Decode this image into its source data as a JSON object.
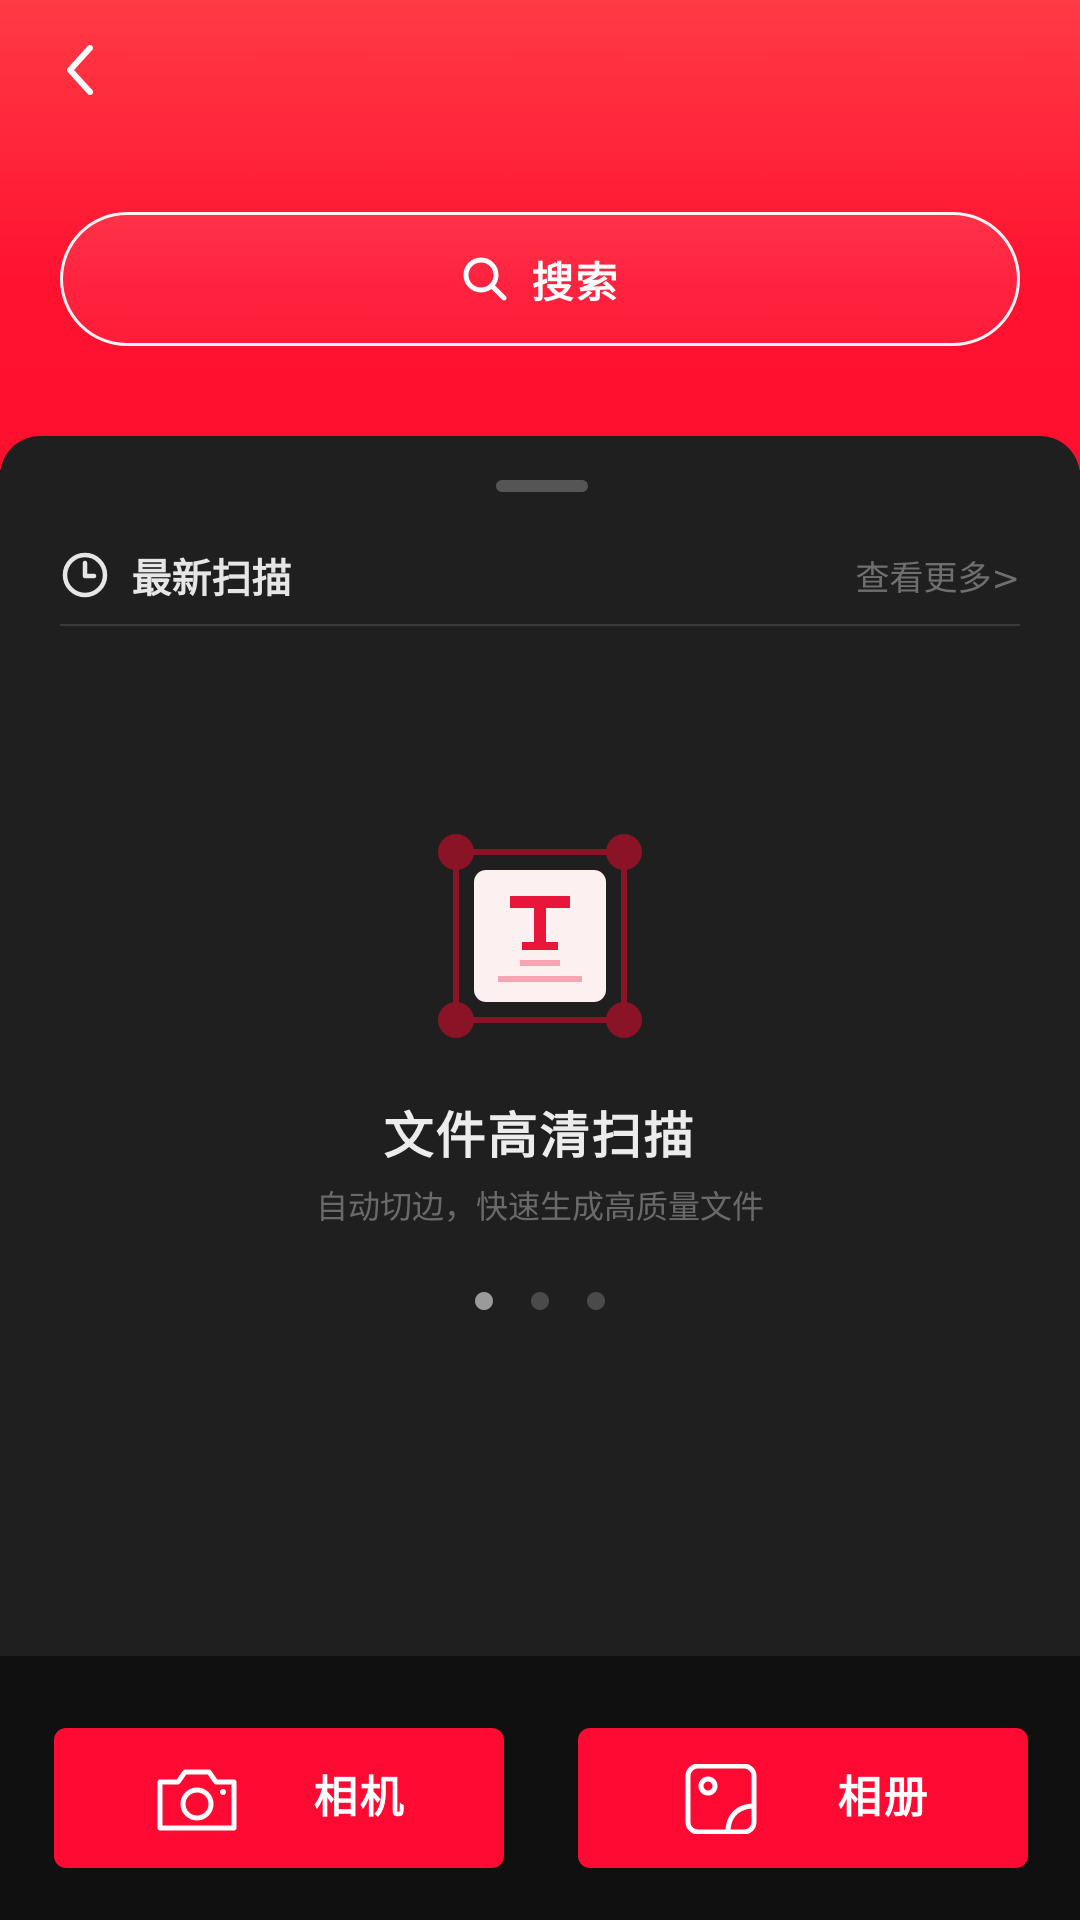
{
  "header": {
    "back_icon": "chevron-left-icon",
    "search": {
      "label": "搜索",
      "icon": "search-icon"
    }
  },
  "recent": {
    "title": "最新扫描",
    "icon": "clock-icon",
    "see_more": "查看更多>"
  },
  "feature": {
    "icon": "text-scan-icon",
    "title": "文件高清扫描",
    "subtitle": "自动切边，快速生成高质量文件",
    "pagination": {
      "current": 1,
      "total": 3
    }
  },
  "actions": {
    "camera": {
      "label": "相机",
      "icon": "camera-icon"
    },
    "album": {
      "label": "相册",
      "icon": "photo-album-icon"
    }
  },
  "colors": {
    "brand_red": "#ff0a33",
    "panel_bg": "#1f1f1f",
    "bottom_bg": "#101010"
  }
}
